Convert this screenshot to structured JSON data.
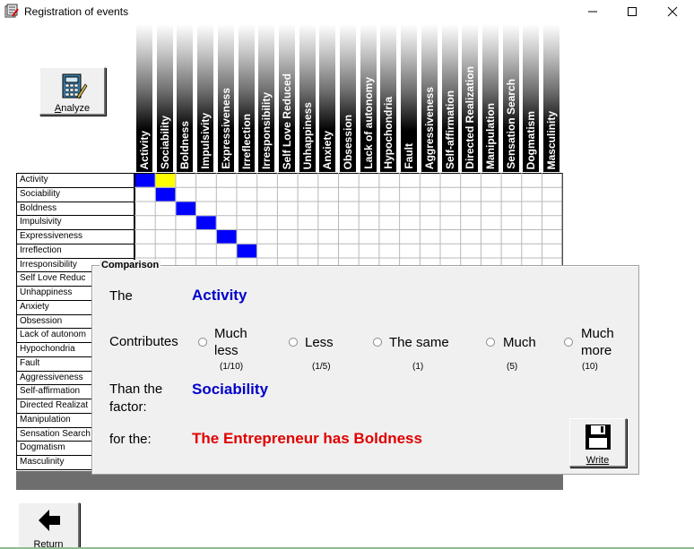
{
  "window": {
    "title": "Registration of events"
  },
  "toolbar": {
    "analyze_label": "Analyze",
    "return_label": "Return"
  },
  "factors": [
    "Activity",
    "Sociability",
    "Boldness",
    "Impulsivity",
    "Expressiveness",
    "Irreflection",
    "Irresponsibility",
    "Self Love Reduced",
    "Unhappiness",
    "Anxiety",
    "Obsession",
    "Lack of autonomy",
    "Hypochondria",
    "Fault",
    "Aggressiveness",
    "Self-affirmation",
    "Directed Realization",
    "Manipulation",
    "Sensation Search",
    "Dogmatism",
    "Masculinity"
  ],
  "row_labels": [
    "Activity",
    "Sociability",
    "Boldness",
    "Impulsivity",
    "Expressiveness",
    "Irreflection",
    "Irresponsibility",
    "Self Love Reduc",
    "Unhappiness",
    "Anxiety",
    "Obsession",
    "Lack of autonom",
    "Hypochondria",
    "Fault",
    "Aggressiveness",
    "Self-affirmation",
    "Directed Realizat",
    "Manipulation",
    "Sensation Search",
    "Dogmatism",
    "Masculinity"
  ],
  "matrix_cells": [
    {
      "row": 0,
      "col": 0,
      "state": "filled"
    },
    {
      "row": 0,
      "col": 1,
      "state": "current"
    },
    {
      "row": 1,
      "col": 1,
      "state": "filled"
    },
    {
      "row": 2,
      "col": 2,
      "state": "filled"
    },
    {
      "row": 3,
      "col": 3,
      "state": "filled"
    },
    {
      "row": 4,
      "col": 4,
      "state": "filled"
    },
    {
      "row": 5,
      "col": 5,
      "state": "filled"
    }
  ],
  "colors": {
    "filled": "#0000ff",
    "current": "#ffff00",
    "factor_text": "#0000cc",
    "event_text": "#e00000"
  },
  "comparison": {
    "title": "Comparison",
    "the_label": "The",
    "factor_a": "Activity",
    "contributes_label": "Contributes",
    "than_label": "Than the factor:",
    "factor_b": "Sociability",
    "for_label": "for the:",
    "event": "The Entrepreneur has Boldness",
    "options": [
      {
        "label": "Much less",
        "scale": "(1/10)"
      },
      {
        "label": "Less",
        "scale": "(1/5)"
      },
      {
        "label": "The same",
        "scale": "(1)"
      },
      {
        "label": "Much",
        "scale": "(5)"
      },
      {
        "label": "Much more",
        "scale": "(10)"
      }
    ],
    "write_label": "Write"
  }
}
